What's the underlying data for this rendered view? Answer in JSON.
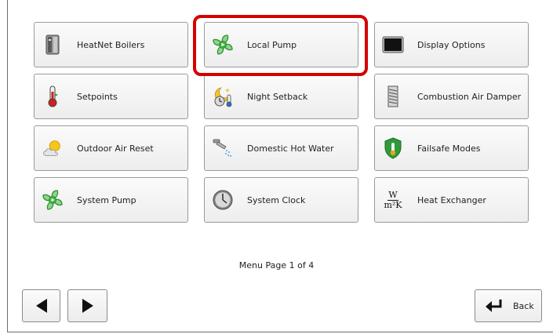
{
  "menu": {
    "items": [
      {
        "label": "HeatNet Boilers",
        "icon": "boiler-icon"
      },
      {
        "label": "Local Pump",
        "icon": "pump-icon"
      },
      {
        "label": "Display Options",
        "icon": "display-icon"
      },
      {
        "label": "Setpoints",
        "icon": "thermometer-icon"
      },
      {
        "label": "Night Setback",
        "icon": "night-setback-icon"
      },
      {
        "label": "Combustion Air Damper",
        "icon": "damper-icon"
      },
      {
        "label": "Outdoor Air Reset",
        "icon": "sun-cloud-icon"
      },
      {
        "label": "Domestic Hot Water",
        "icon": "faucet-icon"
      },
      {
        "label": "Failsafe Modes",
        "icon": "shield-icon"
      },
      {
        "label": "System Pump",
        "icon": "pump-icon"
      },
      {
        "label": "System Clock",
        "icon": "clock-icon"
      },
      {
        "label": "Heat Exchanger",
        "icon": "heat-exchanger-icon"
      }
    ],
    "highlighted": "Local Pump"
  },
  "heat_exchanger_symbol": {
    "numerator": "W",
    "denominator": "m²K"
  },
  "page_indicator": "Menu Page 1 of 4",
  "nav": {
    "back_label": "Back"
  },
  "colors": {
    "highlight": "#d40000",
    "pump_green": "#3cb43c",
    "shield_green": "#2e9a3a"
  }
}
